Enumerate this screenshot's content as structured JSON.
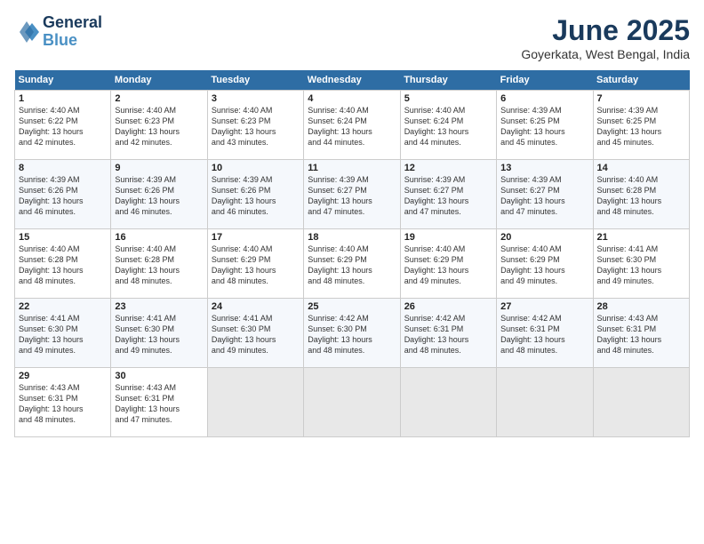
{
  "header": {
    "logo_line1": "General",
    "logo_line2": "Blue",
    "month": "June 2025",
    "location": "Goyerkata, West Bengal, India"
  },
  "weekdays": [
    "Sunday",
    "Monday",
    "Tuesday",
    "Wednesday",
    "Thursday",
    "Friday",
    "Saturday"
  ],
  "weeks": [
    [
      {
        "day": 1,
        "sunrise": "4:40 AM",
        "sunset": "6:22 PM",
        "daylight": "13 hours and 42 minutes."
      },
      {
        "day": 2,
        "sunrise": "4:40 AM",
        "sunset": "6:23 PM",
        "daylight": "13 hours and 42 minutes."
      },
      {
        "day": 3,
        "sunrise": "4:40 AM",
        "sunset": "6:23 PM",
        "daylight": "13 hours and 43 minutes."
      },
      {
        "day": 4,
        "sunrise": "4:40 AM",
        "sunset": "6:24 PM",
        "daylight": "13 hours and 44 minutes."
      },
      {
        "day": 5,
        "sunrise": "4:40 AM",
        "sunset": "6:24 PM",
        "daylight": "13 hours and 44 minutes."
      },
      {
        "day": 6,
        "sunrise": "4:39 AM",
        "sunset": "6:25 PM",
        "daylight": "13 hours and 45 minutes."
      },
      {
        "day": 7,
        "sunrise": "4:39 AM",
        "sunset": "6:25 PM",
        "daylight": "13 hours and 45 minutes."
      }
    ],
    [
      {
        "day": 8,
        "sunrise": "4:39 AM",
        "sunset": "6:26 PM",
        "daylight": "13 hours and 46 minutes."
      },
      {
        "day": 9,
        "sunrise": "4:39 AM",
        "sunset": "6:26 PM",
        "daylight": "13 hours and 46 minutes."
      },
      {
        "day": 10,
        "sunrise": "4:39 AM",
        "sunset": "6:26 PM",
        "daylight": "13 hours and 46 minutes."
      },
      {
        "day": 11,
        "sunrise": "4:39 AM",
        "sunset": "6:27 PM",
        "daylight": "13 hours and 47 minutes."
      },
      {
        "day": 12,
        "sunrise": "4:39 AM",
        "sunset": "6:27 PM",
        "daylight": "13 hours and 47 minutes."
      },
      {
        "day": 13,
        "sunrise": "4:39 AM",
        "sunset": "6:27 PM",
        "daylight": "13 hours and 47 minutes."
      },
      {
        "day": 14,
        "sunrise": "4:40 AM",
        "sunset": "6:28 PM",
        "daylight": "13 hours and 48 minutes."
      }
    ],
    [
      {
        "day": 15,
        "sunrise": "4:40 AM",
        "sunset": "6:28 PM",
        "daylight": "13 hours and 48 minutes."
      },
      {
        "day": 16,
        "sunrise": "4:40 AM",
        "sunset": "6:28 PM",
        "daylight": "13 hours and 48 minutes."
      },
      {
        "day": 17,
        "sunrise": "4:40 AM",
        "sunset": "6:29 PM",
        "daylight": "13 hours and 48 minutes."
      },
      {
        "day": 18,
        "sunrise": "4:40 AM",
        "sunset": "6:29 PM",
        "daylight": "13 hours and 48 minutes."
      },
      {
        "day": 19,
        "sunrise": "4:40 AM",
        "sunset": "6:29 PM",
        "daylight": "13 hours and 49 minutes."
      },
      {
        "day": 20,
        "sunrise": "4:40 AM",
        "sunset": "6:29 PM",
        "daylight": "13 hours and 49 minutes."
      },
      {
        "day": 21,
        "sunrise": "4:41 AM",
        "sunset": "6:30 PM",
        "daylight": "13 hours and 49 minutes."
      }
    ],
    [
      {
        "day": 22,
        "sunrise": "4:41 AM",
        "sunset": "6:30 PM",
        "daylight": "13 hours and 49 minutes."
      },
      {
        "day": 23,
        "sunrise": "4:41 AM",
        "sunset": "6:30 PM",
        "daylight": "13 hours and 49 minutes."
      },
      {
        "day": 24,
        "sunrise": "4:41 AM",
        "sunset": "6:30 PM",
        "daylight": "13 hours and 49 minutes."
      },
      {
        "day": 25,
        "sunrise": "4:42 AM",
        "sunset": "6:30 PM",
        "daylight": "13 hours and 48 minutes."
      },
      {
        "day": 26,
        "sunrise": "4:42 AM",
        "sunset": "6:31 PM",
        "daylight": "13 hours and 48 minutes."
      },
      {
        "day": 27,
        "sunrise": "4:42 AM",
        "sunset": "6:31 PM",
        "daylight": "13 hours and 48 minutes."
      },
      {
        "day": 28,
        "sunrise": "4:43 AM",
        "sunset": "6:31 PM",
        "daylight": "13 hours and 48 minutes."
      }
    ],
    [
      {
        "day": 29,
        "sunrise": "4:43 AM",
        "sunset": "6:31 PM",
        "daylight": "13 hours and 48 minutes."
      },
      {
        "day": 30,
        "sunrise": "4:43 AM",
        "sunset": "6:31 PM",
        "daylight": "13 hours and 47 minutes."
      },
      null,
      null,
      null,
      null,
      null
    ]
  ]
}
